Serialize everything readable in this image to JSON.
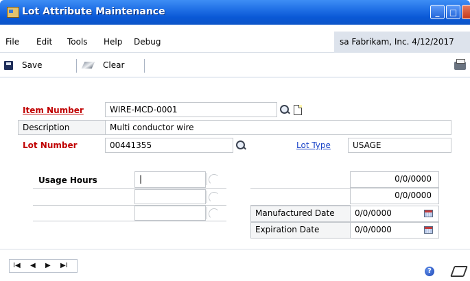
{
  "window": {
    "title": "Lot Attribute Maintenance",
    "min_glyph": "_",
    "max_glyph": "□"
  },
  "menu": [
    "File",
    "Edit",
    "Tools",
    "Help",
    "Debug"
  ],
  "session": {
    "user_company_date": "sa  Fabrikam, Inc.  4/12/2017"
  },
  "toolbar": {
    "save_label": "Save",
    "clear_label": "Clear"
  },
  "form": {
    "item_number_label": "Item Number",
    "item_number_value": "WIRE-MCD-0001",
    "description_label": "Description",
    "description_value": "Multi conductor wire",
    "lot_number_label": "Lot Number",
    "lot_number_value": "00441355",
    "lot_type_label": "Lot Type",
    "lot_type_value": "USAGE"
  },
  "attributes": {
    "rows": [
      {
        "label": "Usage Hours",
        "value": "|"
      },
      {
        "label": "",
        "value": ""
      },
      {
        "label": "",
        "value": ""
      }
    ]
  },
  "dates": {
    "top1": "0/0/0000",
    "top2": "0/0/0000",
    "manufactured_label": "Manufactured Date",
    "manufactured_value": "0/0/0000",
    "expiration_label": "Expiration Date",
    "expiration_value": "0/0/0000"
  },
  "nav": {
    "first": "I◀",
    "prev": "◀",
    "next": "▶",
    "last": "▶I"
  },
  "help": {
    "glyph": "?"
  },
  "icons": {
    "app": "lot-attribute-app-icon",
    "save": "save-icon",
    "clear": "eraser-icon",
    "print": "printer-icon",
    "lookup": "magnifier-lookup-icon",
    "note": "note-icon",
    "calendar": "calendar-icon",
    "help": "help-icon"
  }
}
